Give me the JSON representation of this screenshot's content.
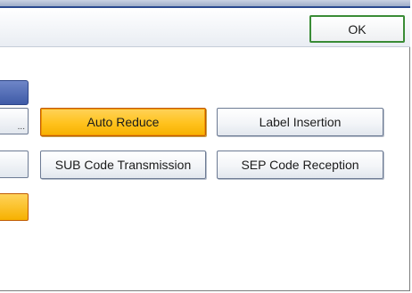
{
  "header": {
    "ok_label": "OK"
  },
  "left_partial": {
    "ellipsis": "..."
  },
  "options": {
    "auto_reduce": "Auto Reduce",
    "label_insertion": "Label Insertion",
    "sub_code_transmission": "SUB Code Transmission",
    "sep_code_reception": "SEP Code Reception"
  },
  "colors": {
    "selected": "#ffc21d",
    "ok_border": "#3a8c36",
    "left_blue": "#3f5ba7"
  }
}
